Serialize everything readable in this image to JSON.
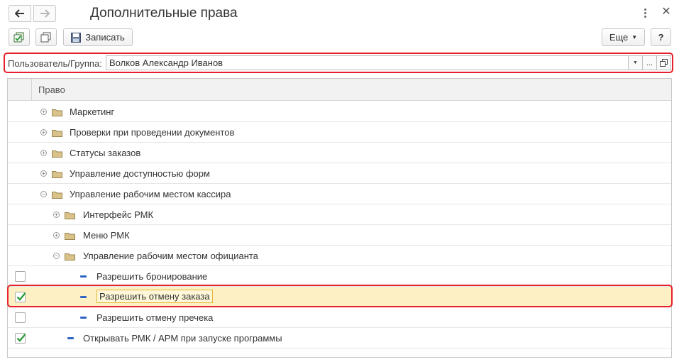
{
  "window": {
    "title": "Дополнительные права"
  },
  "toolbar": {
    "save_label": "Записать",
    "more_label": "Еще",
    "help_label": "?"
  },
  "user_group": {
    "label": "Пользователь/Группа:",
    "value": "Волков Александр Иванов"
  },
  "table": {
    "column_header": "Право",
    "rows": [
      {
        "label": "Маркетинг",
        "type": "folder",
        "expander": "plus",
        "level": 0,
        "checkbox": false,
        "checked": false
      },
      {
        "label": "Проверки при проведении документов",
        "type": "folder",
        "expander": "plus",
        "level": 0,
        "checkbox": false,
        "checked": false
      },
      {
        "label": "Статусы заказов",
        "type": "folder",
        "expander": "plus",
        "level": 0,
        "checkbox": false,
        "checked": false
      },
      {
        "label": "Управление доступностью форм",
        "type": "folder",
        "expander": "plus",
        "level": 0,
        "checkbox": false,
        "checked": false
      },
      {
        "label": "Управление рабочим местом кассира",
        "type": "folder",
        "expander": "minus",
        "level": 0,
        "checkbox": false,
        "checked": false
      },
      {
        "label": "Интерфейс РМК",
        "type": "folder",
        "expander": "plus",
        "level": 1,
        "checkbox": false,
        "checked": false
      },
      {
        "label": "Меню РМК",
        "type": "folder",
        "expander": "plus",
        "level": 1,
        "checkbox": false,
        "checked": false
      },
      {
        "label": "Управление рабочим местом официанта",
        "type": "folder",
        "expander": "minus",
        "level": 1,
        "checkbox": false,
        "checked": false
      },
      {
        "label": "Разрешить бронирование",
        "type": "item",
        "level": 2,
        "checkbox": true,
        "checked": false
      },
      {
        "label": "Разрешить отмену заказа",
        "type": "item",
        "level": 2,
        "checkbox": true,
        "checked": true,
        "selected": true
      },
      {
        "label": "Разрешить отмену пречека",
        "type": "item",
        "level": 2,
        "checkbox": true,
        "checked": false
      },
      {
        "label": "Открывать РМК / АРМ при запуске программы",
        "type": "item",
        "level": 1,
        "checkbox": true,
        "checked": true
      }
    ]
  },
  "colors": {
    "highlight_border": "#e8202a",
    "selected_row": "#fcf0c4",
    "check_green": "#2e9e3c",
    "item_dash": "#2f64c5",
    "folder": "#d9c38a"
  }
}
